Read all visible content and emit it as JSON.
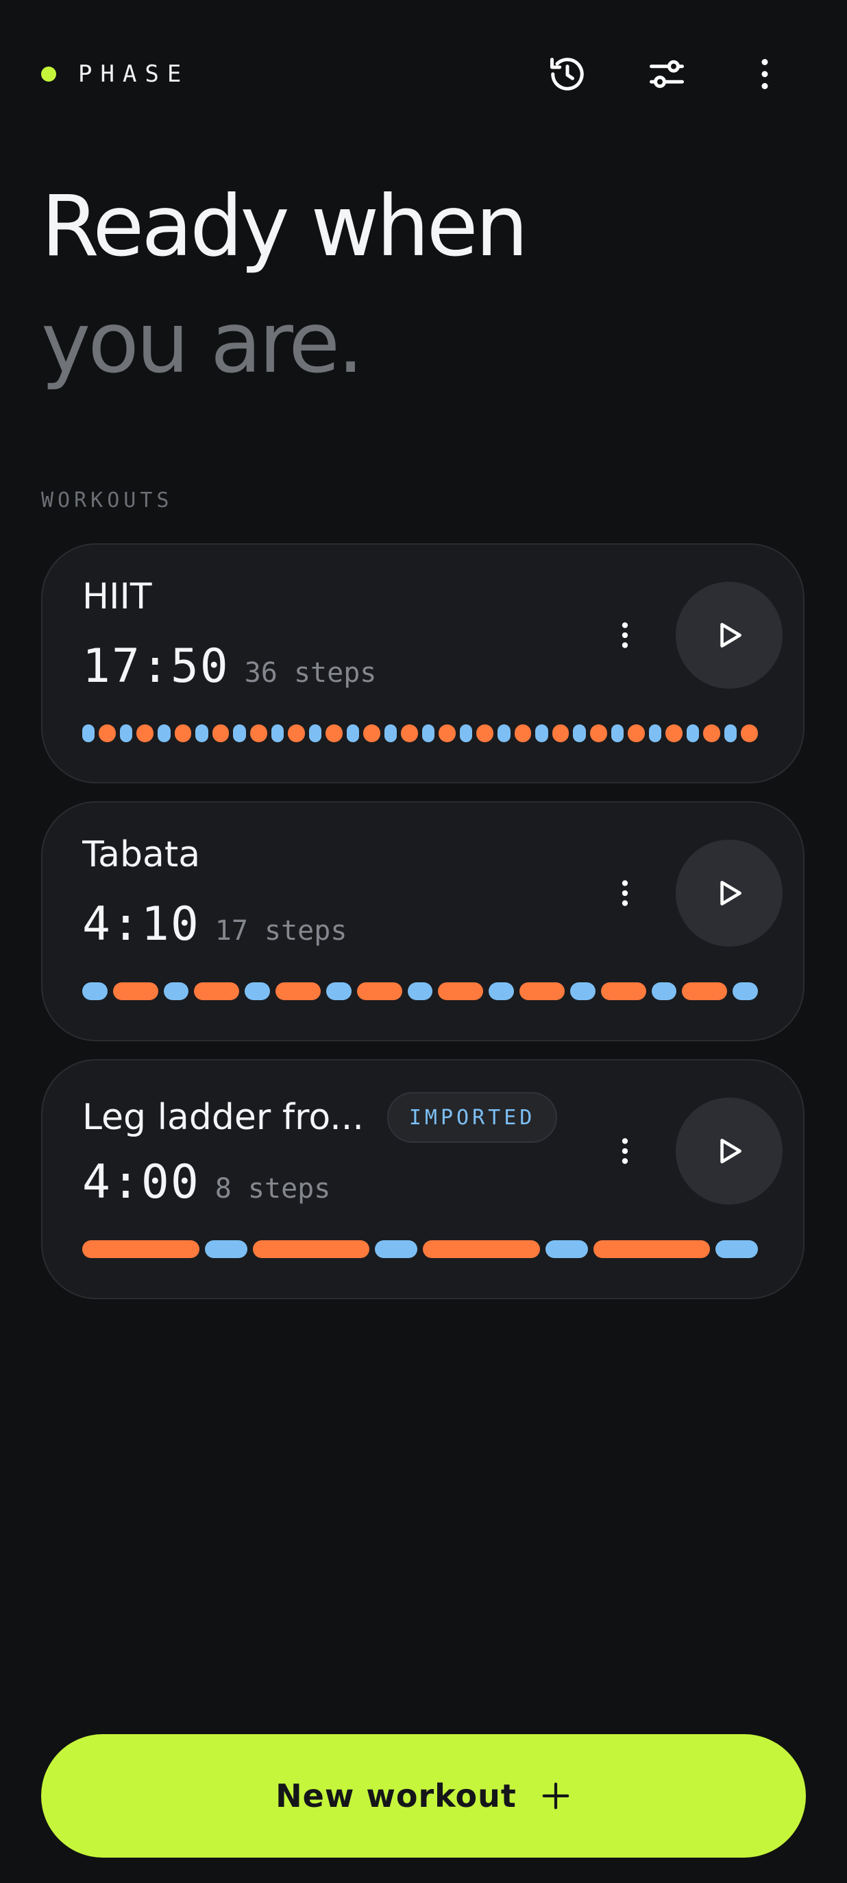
{
  "app": {
    "name": "PHASE",
    "accent_color": "#c6f63c"
  },
  "toolbar": {
    "icons": [
      "history-icon",
      "tune-icon",
      "more-vertical-icon"
    ]
  },
  "headline": {
    "line1": "Ready when",
    "line2": "you are."
  },
  "section": {
    "label": "WORKOUTS"
  },
  "colors": {
    "work": "#ff7a3d",
    "rest": "#7dbff4",
    "card_bg": "#1a1b1e"
  },
  "workouts": [
    {
      "title": "HIIT",
      "duration": "17:50",
      "steps": "36 steps",
      "step_pattern": [
        "rest",
        "work",
        "rest",
        "work",
        "rest",
        "work",
        "rest",
        "work",
        "rest",
        "work",
        "rest",
        "work",
        "rest",
        "work",
        "rest",
        "work",
        "rest",
        "work",
        "rest",
        "work",
        "rest",
        "work",
        "rest",
        "work",
        "rest",
        "work",
        "rest",
        "work",
        "rest",
        "work",
        "rest",
        "work",
        "rest",
        "work",
        "rest",
        "work"
      ]
    },
    {
      "title": "Tabata",
      "duration": "4:10",
      "steps": "17 steps",
      "step_pattern": [
        "rest",
        "work",
        "rest",
        "work",
        "rest",
        "work",
        "rest",
        "work",
        "rest",
        "work",
        "rest",
        "work",
        "rest",
        "work",
        "rest",
        "work",
        "rest"
      ]
    },
    {
      "title": "Leg ladder fro...",
      "badge": "IMPORTED",
      "duration": "4:00",
      "steps": "8 steps",
      "step_pattern": [
        "work",
        "rest",
        "work",
        "rest",
        "work",
        "rest",
        "work",
        "rest"
      ]
    }
  ],
  "new_workout": {
    "label": "New workout",
    "icon": "plus-icon"
  }
}
